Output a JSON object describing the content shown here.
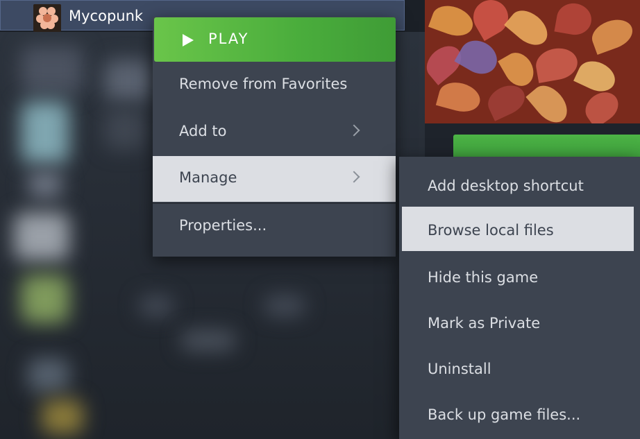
{
  "selected_game": {
    "title": "Mycopunk",
    "thumbnail_icon": "mycopunk-game-icon"
  },
  "context_menu": {
    "play_label": "PLAY",
    "items": [
      {
        "label": "Remove from Favorites",
        "has_submenu": false
      },
      {
        "label": "Add to",
        "has_submenu": true
      },
      {
        "label": "Manage",
        "has_submenu": true,
        "active": true
      },
      {
        "label": "Properties...",
        "has_submenu": false
      }
    ]
  },
  "manage_submenu": {
    "items": [
      {
        "label": "Add desktop shortcut"
      },
      {
        "label": "Browse local files",
        "active": true
      },
      {
        "label": "Hide this game"
      },
      {
        "label": "Mark as Private"
      },
      {
        "label": "Uninstall"
      },
      {
        "label": "Back up game files..."
      }
    ]
  },
  "colors": {
    "play_green": "#5bbf45",
    "menu_bg": "#3d4450",
    "highlight_bg": "#dcdee3",
    "selected_row_bg": "#3d4a63"
  }
}
